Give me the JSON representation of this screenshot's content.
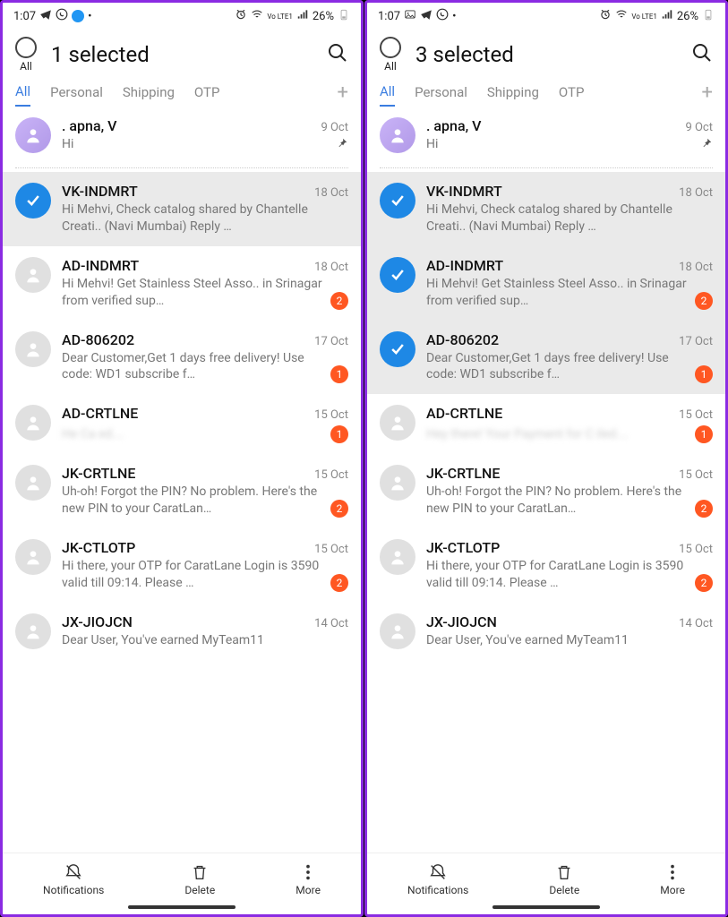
{
  "phones": [
    {
      "statusbar": {
        "time": "1:07",
        "battery": "26%",
        "network": "Vo LTE1"
      },
      "header": {
        "title": "1 selected",
        "all_label": "All"
      },
      "tabs": [
        "All",
        "Personal",
        "Shipping",
        "OTP"
      ],
      "activeTab": 0,
      "pinned": {
        "sender": ". apna, V",
        "date": "9 Oct",
        "preview": "Hi"
      },
      "messages": [
        {
          "sender": "VK-INDMRT",
          "date": "18 Oct",
          "preview": "Hi Mehvi, Check catalog shared by Chantelle Creati.. (Navi Mumbai)  Reply …",
          "selected": true
        },
        {
          "sender": "AD-INDMRT",
          "date": "18 Oct",
          "preview": "Hi Mehvi! Get Stainless Steel Asso.. in Srinagar from verified sup…",
          "badge": 2
        },
        {
          "sender": "AD-806202",
          "date": "17 Oct",
          "preview": "Dear Customer,Get 1 days free delivery! Use code: WD1 subscribe f…",
          "badge": 1
        },
        {
          "sender": "AD-CRTLNE",
          "date": "15 Oct",
          "preview": "He Ca ed.…",
          "badge": 1,
          "blurred": true
        },
        {
          "sender": "JK-CRTLNE",
          "date": "15 Oct",
          "preview": "Uh-oh! Forgot the PIN? No problem. Here's the new PIN to your CaratLan…",
          "badge": 2
        },
        {
          "sender": "JK-CTLOTP",
          "date": "15 Oct",
          "preview": "Hi there, your OTP for CaratLane Login is 3590 valid till 09:14. Please …",
          "badge": 2
        },
        {
          "sender": "JX-JIOJCN",
          "date": "14 Oct",
          "preview": "Dear User,  You've earned MyTeam11"
        }
      ],
      "bottombar": {
        "notifications": "Notifications",
        "delete": "Delete",
        "more": "More"
      }
    },
    {
      "statusbar": {
        "time": "1:07",
        "battery": "26%",
        "network": "Vo LTE1"
      },
      "header": {
        "title": "3 selected",
        "all_label": "All"
      },
      "tabs": [
        "All",
        "Personal",
        "Shipping",
        "OTP"
      ],
      "activeTab": 0,
      "pinned": {
        "sender": ". apna, V",
        "date": "9 Oct",
        "preview": "Hi"
      },
      "messages": [
        {
          "sender": "VK-INDMRT",
          "date": "18 Oct",
          "preview": "Hi Mehvi, Check catalog shared by Chantelle Creati.. (Navi Mumbai)  Reply …",
          "selected": true
        },
        {
          "sender": "AD-INDMRT",
          "date": "18 Oct",
          "preview": "Hi Mehvi! Get Stainless Steel Asso.. in Srinagar from verified sup…",
          "badge": 2,
          "selected": true
        },
        {
          "sender": "AD-806202",
          "date": "17 Oct",
          "preview": "Dear Customer,Get 1 days free delivery! Use code: WD1 subscribe f…",
          "badge": 1,
          "selected": true
        },
        {
          "sender": "AD-CRTLNE",
          "date": "15 Oct",
          "preview": "Hey there! Your Payment for C iled.…",
          "badge": 1,
          "blurred": true
        },
        {
          "sender": "JK-CRTLNE",
          "date": "15 Oct",
          "preview": "Uh-oh! Forgot the PIN? No problem. Here's the new PIN to your CaratLan…",
          "badge": 2
        },
        {
          "sender": "JK-CTLOTP",
          "date": "15 Oct",
          "preview": "Hi there, your OTP for CaratLane Login is 3590 valid till 09:14. Please …",
          "badge": 2
        },
        {
          "sender": "JX-JIOJCN",
          "date": "14 Oct",
          "preview": "Dear User,  You've earned MyTeam11"
        }
      ],
      "bottombar": {
        "notifications": "Notifications",
        "delete": "Delete",
        "more": "More"
      }
    }
  ]
}
